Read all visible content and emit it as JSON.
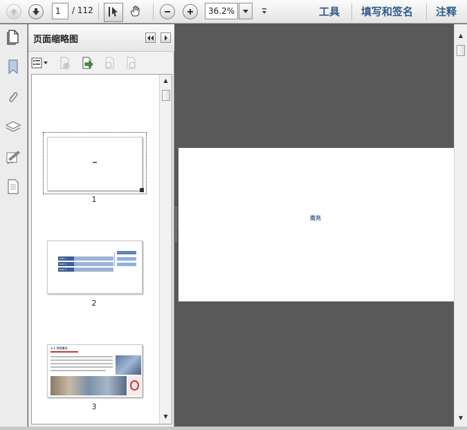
{
  "toolbar": {
    "page_current": "1",
    "page_total": "/ 112",
    "zoom": "36.2%",
    "tools_label": "工具",
    "fill_sign_label": "填写和签名",
    "comment_label": "注释"
  },
  "panel": {
    "title": "页面缩略图",
    "thumbnails": [
      {
        "number": "1"
      },
      {
        "number": "2"
      },
      {
        "number": "3"
      }
    ],
    "thumb2_rows": [
      "PART 1",
      "PART 2",
      "PART 3"
    ],
    "thumb3_title": "1.1 项目概况"
  },
  "document": {
    "page_text": "南充"
  },
  "colors": {
    "accent": "#2f5b8c",
    "doc_background": "#595959",
    "thumb_bar": "#4a6fa5"
  },
  "icons": [
    "up-arrow-icon",
    "down-arrow-icon",
    "select-cursor-icon",
    "hand-icon",
    "zoom-out-icon",
    "zoom-in-icon",
    "pages-icon",
    "bookmark-icon",
    "attachment-icon",
    "layers-icon",
    "signature-icon",
    "document-icon"
  ]
}
